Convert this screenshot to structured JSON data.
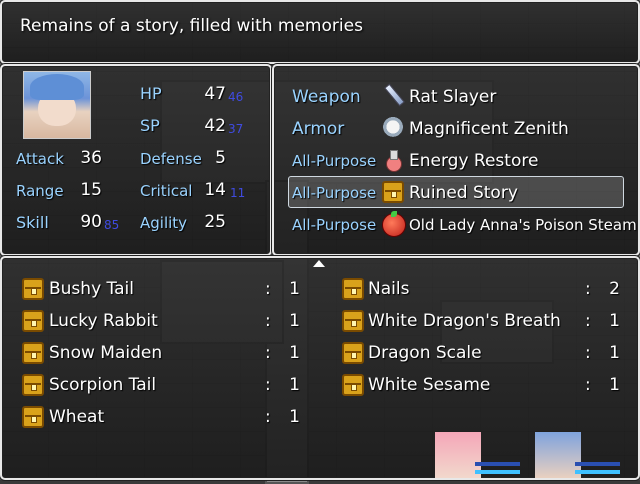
{
  "help": {
    "text": "Remains of a story, filled with memories"
  },
  "status": {
    "hp_label": "HP",
    "hp": "47",
    "hp_sub": "46",
    "sp_label": "SP",
    "sp": "42",
    "sp_sub": "37",
    "attack_label": "Attack",
    "attack": "36",
    "defense_label": "Defense",
    "defense": "5",
    "range_label": "Range",
    "range": "15",
    "critical_label": "Critical",
    "critical": "14",
    "critical_sub": "11",
    "skill_label": "Skill",
    "skill": "90",
    "skill_sub": "85",
    "agility_label": "Agility",
    "agility": "25"
  },
  "equipment": [
    {
      "slot": "Weapon",
      "icon": "sword-icon",
      "name": "Rat Slayer"
    },
    {
      "slot": "Armor",
      "icon": "armor-icon",
      "name": "Magnificent Zenith"
    },
    {
      "slot": "All-Purpose",
      "icon": "potion-icon",
      "name": "Energy Restore"
    },
    {
      "slot": "All-Purpose",
      "icon": "chest-icon",
      "name": "Ruined Story"
    },
    {
      "slot": "All-Purpose",
      "icon": "bun-icon",
      "name": "Old Lady Anna's Poison Steam Bun"
    }
  ],
  "items_left": [
    {
      "name": "Bushy Tail",
      "qty": "1"
    },
    {
      "name": "Lucky Rabbit",
      "qty": "1"
    },
    {
      "name": "Snow Maiden",
      "qty": "1"
    },
    {
      "name": "Scorpion Tail",
      "qty": "1"
    },
    {
      "name": "Wheat",
      "qty": "1"
    }
  ],
  "items_right": [
    {
      "name": "Nails",
      "qty": "2"
    },
    {
      "name": "White Dragon's Breath",
      "qty": "1"
    },
    {
      "name": "Dragon Scale",
      "qty": "1"
    },
    {
      "name": "White Sesame",
      "qty": "1"
    }
  ],
  "colon": ":",
  "colors": {
    "label_blue": "#9ad3ff",
    "sub_blue": "#3f4be0",
    "chest_gold": "#d9a21b"
  }
}
